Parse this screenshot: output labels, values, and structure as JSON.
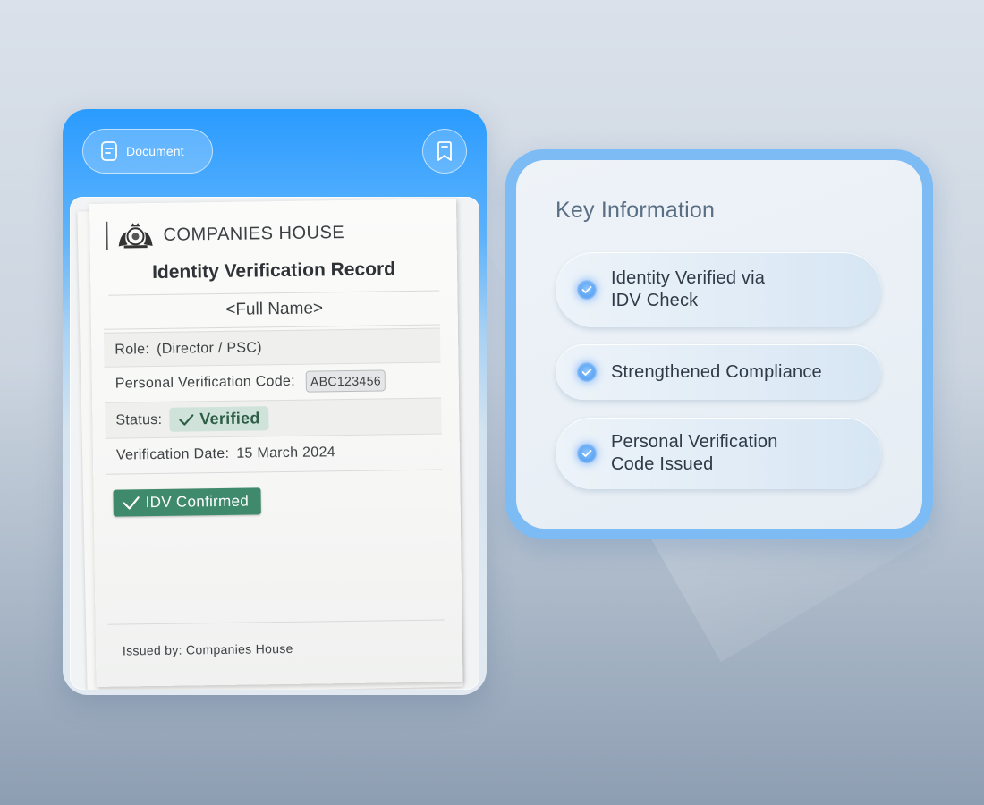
{
  "phone": {
    "document_chip_label": "Document",
    "icons": {
      "document": "document-icon",
      "bookmark": "bookmark-icon",
      "crest": "royal-crest-icon",
      "check": "checkmark-icon"
    }
  },
  "record": {
    "organisation": "COMPANIES HOUSE",
    "title": "Identity Verification Record",
    "full_name": "<Full Name>",
    "role_label": "Role:",
    "role_value": "(Director / PSC)",
    "code_label": "Personal Verification Code:",
    "code_value": "ABC123456",
    "status_label": "Status:",
    "status_value": "Verified",
    "date_label": "Verification Date:",
    "date_value": "15 March 2024",
    "idv_badge": "IDV Confirmed",
    "issued_by": "Issued by: Companies House"
  },
  "key_info": {
    "title": "Key Information",
    "items": [
      {
        "line1": "Identity Verified via",
        "line2": "IDV Check"
      },
      {
        "line1": "Strengthened Compliance",
        "line2": ""
      },
      {
        "line1": "Personal Verification",
        "line2": "Code Issued"
      }
    ]
  },
  "colors": {
    "accent_blue": "#2a9bff",
    "card_border": "#7dbbf5",
    "verified_green": "#3f8a6c",
    "verified_pill_bg": "#cfe3da"
  }
}
